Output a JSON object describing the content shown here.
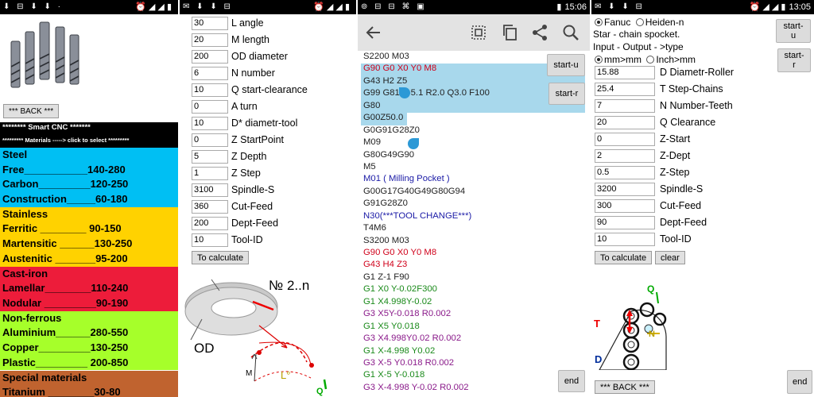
{
  "panels": [
    {
      "statusbar": {
        "icons_left": "⬇ ⊟ ⬇ ⬇ ·",
        "icons_right": "⏰ ◢ ◢ ▮",
        "time": ""
      }
    },
    {
      "statusbar": {
        "icons_left": "✉ ⬇ ⬇ ⊟",
        "icons_right": "⏰ ◢ ◢ ▮",
        "time": ""
      }
    },
    {
      "statusbar": {
        "icons_left": "⊚ ⊟ ⊟ ⌘ ▣",
        "icons_right": "▮",
        "time": "15:06"
      }
    },
    {
      "statusbar": {
        "icons_left": "✉ ⬇ ⬇ ⊟",
        "icons_right": "⏰ ◢ ◢ ▮",
        "time": "13:05"
      }
    }
  ],
  "screen1": {
    "back_label": "*** BACK ***",
    "title": "******** Smart CNC *******",
    "subtitle": "********* Materials -----> click to select *********",
    "materials": [
      {
        "color": "#00bff3",
        "lines": [
          "Steel",
          "Free___________140-280",
          "Carbon_________120-250",
          "Construction_____60-180"
        ]
      },
      {
        "color": "#ffd200",
        "lines": [
          "Stainless",
          "Ferritic ________ 90-150",
          "Martensitic ______130-250",
          "Austenitic _______95-200"
        ]
      },
      {
        "color": "#ed1c3a",
        "lines": [
          "Cast-iron",
          "Lamellar________110-240",
          "Nodular _________90-190"
        ]
      },
      {
        "color": "#a6ff2a",
        "lines": [
          "Non-ferrous",
          "Aluminium______280-550",
          "Copper_________130-250",
          "Plastic_________ 200-850"
        ]
      },
      {
        "color": "#c0632f",
        "lines": [
          "Special materials",
          "Titanium ________30-80"
        ]
      }
    ]
  },
  "screen2": {
    "fields": [
      {
        "value": "30",
        "label": "L angle"
      },
      {
        "value": "20",
        "label": "M length"
      },
      {
        "value": "200",
        "label": "OD diameter"
      },
      {
        "value": "6",
        "label": "N number"
      },
      {
        "value": "10",
        "label": "Q start-clearance"
      },
      {
        "value": "0",
        "label": "A turn"
      },
      {
        "value": "10",
        "label": "D* diametr-tool"
      },
      {
        "value": "0",
        "label": "Z StartPoint"
      },
      {
        "value": "5",
        "label": "Z Depth"
      },
      {
        "value": "1",
        "label": "Z Step"
      },
      {
        "value": "3100",
        "label": "Spindle-S"
      },
      {
        "value": "360",
        "label": "Cut-Feed"
      },
      {
        "value": "200",
        "label": "Dept-Feed"
      },
      {
        "value": "10",
        "label": "Tool-ID"
      }
    ],
    "calc_label": "To calculate",
    "diagram": {
      "n_label": "№ 2..n",
      "od_label": "OD",
      "m_label": "M",
      "l_label": "L°",
      "q_label": "Q"
    }
  },
  "screen3": {
    "code": [
      {
        "t": "S2200 M03",
        "c": "#222"
      },
      {
        "t": "G90 G0 X0 Y0 M8",
        "c": "#d0021b"
      },
      {
        "t": "G43 H2 Z5",
        "c": "#222"
      },
      {
        "t": "G99 G81 Z-5.1 R2.0 Q3.0 F100",
        "c": "#222"
      },
      {
        "t": "G80",
        "c": "#222"
      },
      {
        "t": "G00Z50.0",
        "c": "#222"
      },
      {
        "t": "G0G91G28Z0",
        "c": "#222"
      },
      {
        "t": "M09",
        "c": "#222"
      },
      {
        "t": "G80G49G90",
        "c": "#222"
      },
      {
        "t": "M5",
        "c": "#222"
      },
      {
        "t": "M01 ( Milling Pocket )",
        "c": "#1a1aa6"
      },
      {
        "t": "G00G17G40G49G80G94",
        "c": "#222"
      },
      {
        "t": "G91G28Z0",
        "c": "#222"
      },
      {
        "t": "N30(***TOOL CHANGE***)",
        "c": "#1a1aa6"
      },
      {
        "t": "T4M6",
        "c": "#222"
      },
      {
        "t": "S3200 M03",
        "c": "#222"
      },
      {
        "t": "G90 G0 X0 Y0 M8",
        "c": "#d0021b"
      },
      {
        "t": "G43 H4 Z3",
        "c": "#d0021b"
      },
      {
        "t": "G1 Z-1 F90",
        "c": "#222"
      },
      {
        "t": "G1 X0 Y-0.02F300",
        "c": "#1a8a1a"
      },
      {
        "t": "G1 X4.998Y-0.02",
        "c": "#1a8a1a"
      },
      {
        "t": "G3 X5Y-0.018 R0.002",
        "c": "#8a1a8a"
      },
      {
        "t": "G1 X5 Y0.018",
        "c": "#1a8a1a"
      },
      {
        "t": "G3 X4.998Y0.02 R0.002",
        "c": "#8a1a8a"
      },
      {
        "t": "G1 X-4.998 Y0.02",
        "c": "#1a8a1a"
      },
      {
        "t": "G3 X-5 Y0.018 R0.002",
        "c": "#8a1a8a"
      },
      {
        "t": "G1 X-5 Y-0.018",
        "c": "#1a8a1a"
      },
      {
        "t": "G3 X-4.998 Y-0.02 R0.002",
        "c": "#8a1a8a"
      }
    ],
    "start_u_label": "start-u",
    "start_r_label": "start-r",
    "end_label": "end"
  },
  "screen4": {
    "radio_fanuc": "Fanuc",
    "radio_heiden": "Heiden-n",
    "title": "Star - chain spocket.",
    "io_label": "Input - Output - >type",
    "radio_mm": "mm>mm",
    "radio_inch": "Inch>mm",
    "fields": [
      {
        "value": "15.88",
        "label": "D Diametr-Roller"
      },
      {
        "value": "25.4",
        "label": "T Step-Chains"
      },
      {
        "value": "7",
        "label": "N Number-Teeth"
      },
      {
        "value": "20",
        "label": "Q Clearance"
      },
      {
        "value": "0",
        "label": "Z-Start"
      },
      {
        "value": "2",
        "label": "Z-Dept"
      },
      {
        "value": "0.5",
        "label": "Z-Step"
      },
      {
        "value": "3200",
        "label": "Spindle-S"
      },
      {
        "value": "300",
        "label": "Cut-Feed"
      },
      {
        "value": "90",
        "label": "Dept-Feed"
      },
      {
        "value": "10",
        "label": "Tool-ID"
      }
    ],
    "calc_label": "To calculate",
    "clear_label": "clear",
    "start_u_label": "start-u",
    "start_r_label": "start-r",
    "back_label": "*** BACK ***",
    "end_label": "end",
    "diagram": {
      "t_label": "T",
      "d_label": "D",
      "q_label": "Q",
      "n_label": "N"
    }
  }
}
